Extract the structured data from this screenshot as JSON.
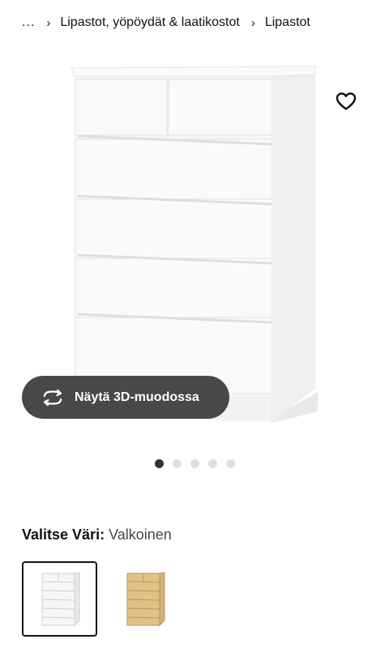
{
  "breadcrumb": {
    "ellipsis": "...",
    "items": [
      "Lipastot, yöpöydät & laatikostot",
      "Lipastot"
    ]
  },
  "product_image": {
    "alt": "Valkoinen lipasto, 6 laatikkoa",
    "favorite_icon": "heart-outline-icon"
  },
  "view3d": {
    "label": "Näytä 3D-muodossa",
    "icon": "rotate-3d-icon"
  },
  "carousel": {
    "count": 5,
    "active_index": 0
  },
  "color_selector": {
    "label": "Valitse Väri:",
    "value": "Valkoinen",
    "options": [
      {
        "name": "Valkoinen",
        "selected": true,
        "color": "#f4f4f2"
      },
      {
        "name": "Tammiviilu",
        "selected": false,
        "color": "#e2c189"
      }
    ]
  },
  "colors": {
    "button_bg": "#484848",
    "dot_active": "#333333",
    "dot_inactive": "#dfdfdf"
  }
}
